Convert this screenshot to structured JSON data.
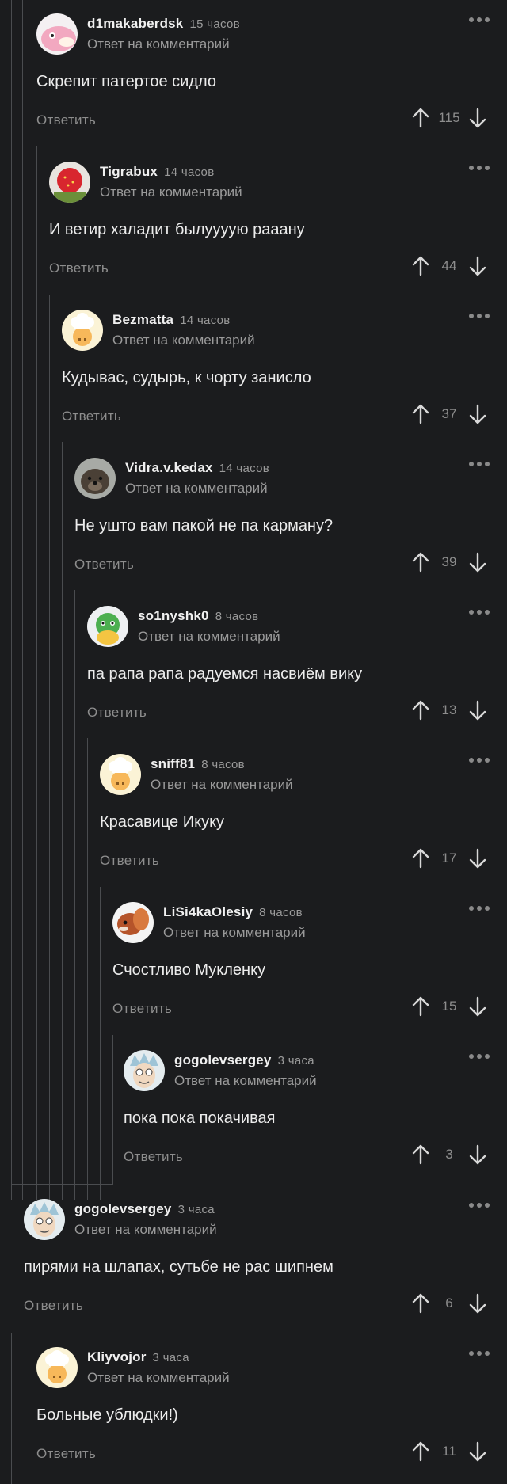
{
  "comments": [
    {
      "username": "d1makaberdsk",
      "time": "15 часов",
      "reply_note": "Ответ на комментарий",
      "text": "Скрепит патертое сидло",
      "reply_label": "Ответить",
      "score": "115",
      "avatar": "slowpoke-avatar"
    },
    {
      "username": "Tigrabux",
      "time": "14 часов",
      "reply_note": "Ответ на комментарий",
      "text": "И ветир халадит былуууую рааану",
      "reply_label": "Ответить",
      "score": "44",
      "avatar": "strawberry-avatar"
    },
    {
      "username": "Bezmatta",
      "time": "14 часов",
      "reply_note": "Ответ на комментарий",
      "text": "Кудывас, судырь, к чорту занисло",
      "reply_label": "Ответить",
      "score": "37",
      "avatar": "default-chef-avatar"
    },
    {
      "username": "Vidra.v.kedax",
      "time": "14 часов",
      "reply_note": "Ответ на комментарий",
      "text": "Не ушто вам пакой не па карману?",
      "reply_label": "Ответить",
      "score": "39",
      "avatar": "otter-avatar"
    },
    {
      "username": "so1nyshk0",
      "time": "8 часов",
      "reply_note": "Ответ на комментарий",
      "text": "па рапа рапа радуемся насвиём вику",
      "reply_label": "Ответить",
      "score": "13",
      "avatar": "dragon-avatar"
    },
    {
      "username": "sniff81",
      "time": "8 часов",
      "reply_note": "Ответ на комментарий",
      "text": "Красавице Икуку",
      "reply_label": "Ответить",
      "score": "17",
      "avatar": "default-chef-avatar"
    },
    {
      "username": "LiSi4kaOlesiy",
      "time": "8 часов",
      "reply_note": "Ответ на комментарий",
      "text": "Счостливо Мукленку",
      "reply_label": "Ответить",
      "score": "15",
      "avatar": "squirrel-avatar"
    },
    {
      "username": "gogolevsergey",
      "time": "3 часа",
      "reply_note": "Ответ на комментарий",
      "text": "пока пока покачивая",
      "reply_label": "Ответить",
      "score": "3",
      "avatar": "rick-avatar"
    },
    {
      "username": "gogolevsergey",
      "time": "3 часа",
      "reply_note": "Ответ на комментарий",
      "text": "пирями на шлапах, сутьбе не рас шипнем",
      "reply_label": "Ответить",
      "score": "6",
      "avatar": "rick-avatar"
    },
    {
      "username": "Kliyvojor",
      "time": "3 часа",
      "reply_note": "Ответ на комментарий",
      "text": "Больные ублюдки!)",
      "reply_label": "Ответить",
      "score": "11",
      "avatar": "default-chef-avatar"
    }
  ],
  "colors": {
    "background": "#1b1c1e",
    "thread_line": "#4a4c4f",
    "muted_text": "#9a9a9a",
    "body_text": "#ececec"
  }
}
